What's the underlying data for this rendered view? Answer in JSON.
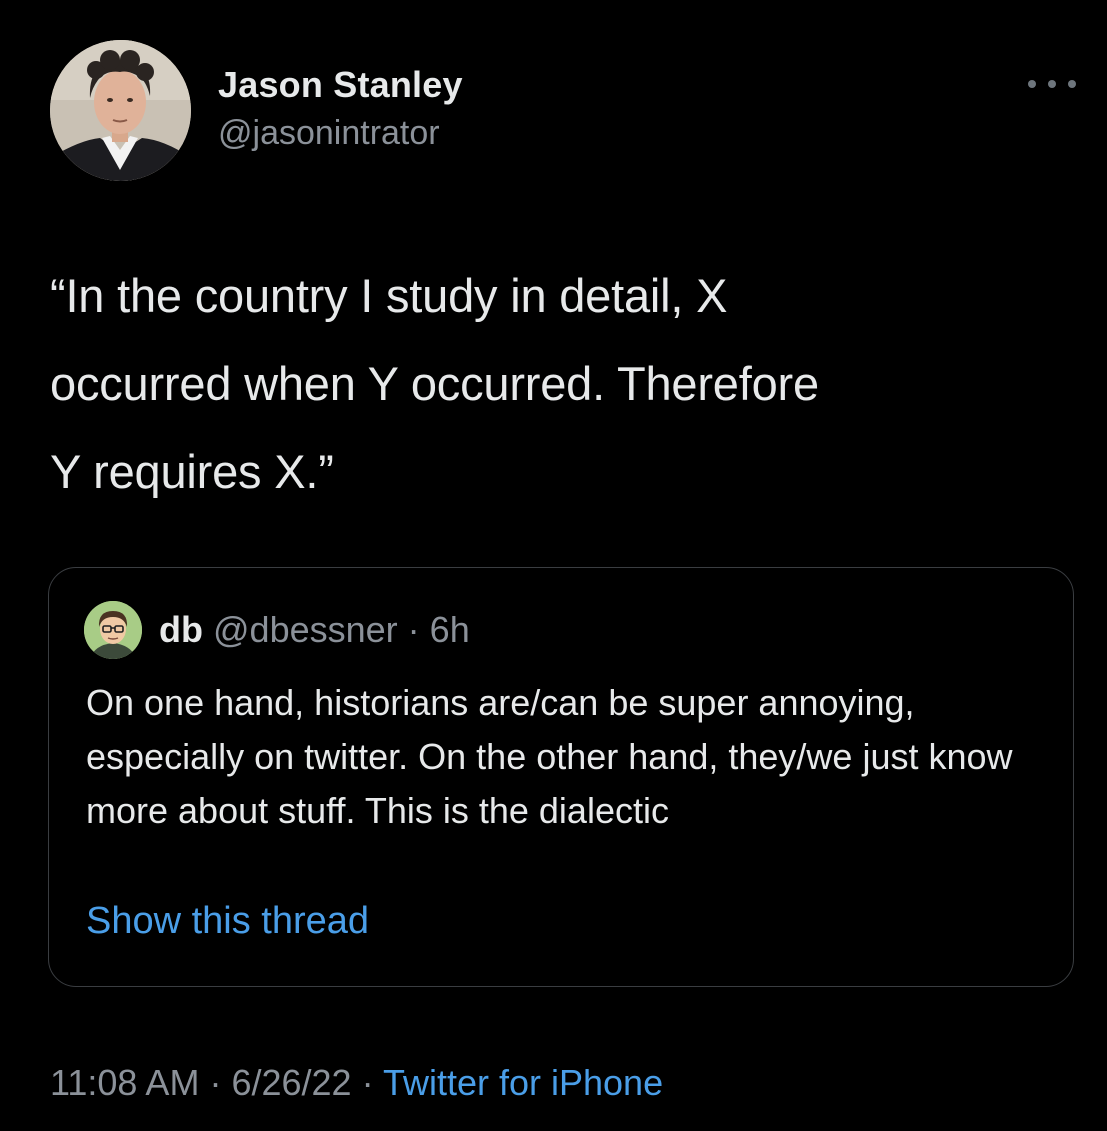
{
  "author": {
    "name": "Jason Stanley",
    "handle": "@jasonintrator",
    "avatar_icon": "profile-photo"
  },
  "more_icon": "more-horizontal-icon",
  "tweet": {
    "text": "“In the country I study in detail, X\noccurred when Y occurred. Therefore\nY requires X.”"
  },
  "quoted_tweet": {
    "name": "db",
    "handle": "@dbessner",
    "separator": "·",
    "time": "6h",
    "text": "On one hand, historians are/can be super annoying, especially on twitter. On the other hand, they/we just know more about stuff. This is the dialectic",
    "show_thread_label": "Show this thread"
  },
  "meta": {
    "time": "11:08 AM",
    "separator": "·",
    "date": "6/26/22",
    "source": "Twitter for iPhone"
  },
  "colors": {
    "background": "#000000",
    "text": "#e7e9ea",
    "secondary_text": "#8b9199",
    "link": "#4a9ee8",
    "border": "#3a3d41"
  }
}
